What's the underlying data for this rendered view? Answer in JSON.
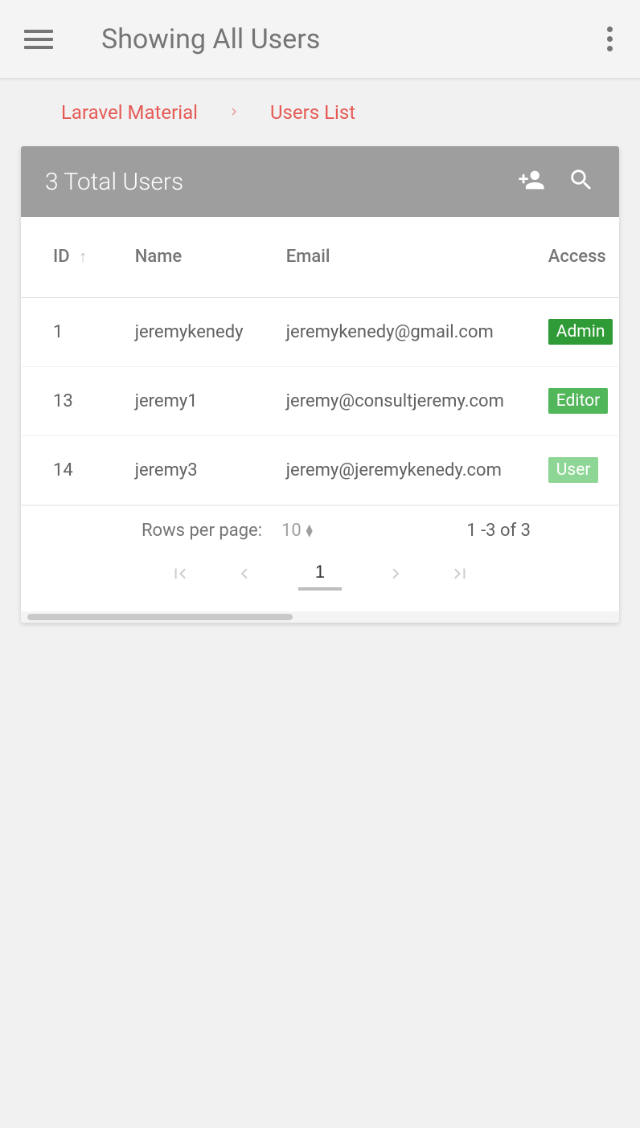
{
  "appbar": {
    "title": "Showing All Users"
  },
  "breadcrumb": {
    "items": [
      "Laravel Material",
      "Users List"
    ]
  },
  "card": {
    "title": "3 Total Users"
  },
  "table": {
    "headers": {
      "id": "ID",
      "name": "Name",
      "email": "Email",
      "access": "Access"
    },
    "rows": [
      {
        "id": "1",
        "name": "jeremykenedy",
        "email": "jeremykenedy@gmail.com",
        "access": "Admin",
        "badge": "admin"
      },
      {
        "id": "13",
        "name": "jeremy1",
        "email": "jeremy@consultjeremy.com",
        "access": "Editor",
        "badge": "editor"
      },
      {
        "id": "14",
        "name": "jeremy3",
        "email": "jeremy@jeremykenedy.com",
        "access": "User",
        "badge": "user"
      }
    ]
  },
  "pagination": {
    "rows_label": "Rows per page:",
    "rows_value": "10",
    "range": "1 -3 of 3",
    "page": "1"
  }
}
